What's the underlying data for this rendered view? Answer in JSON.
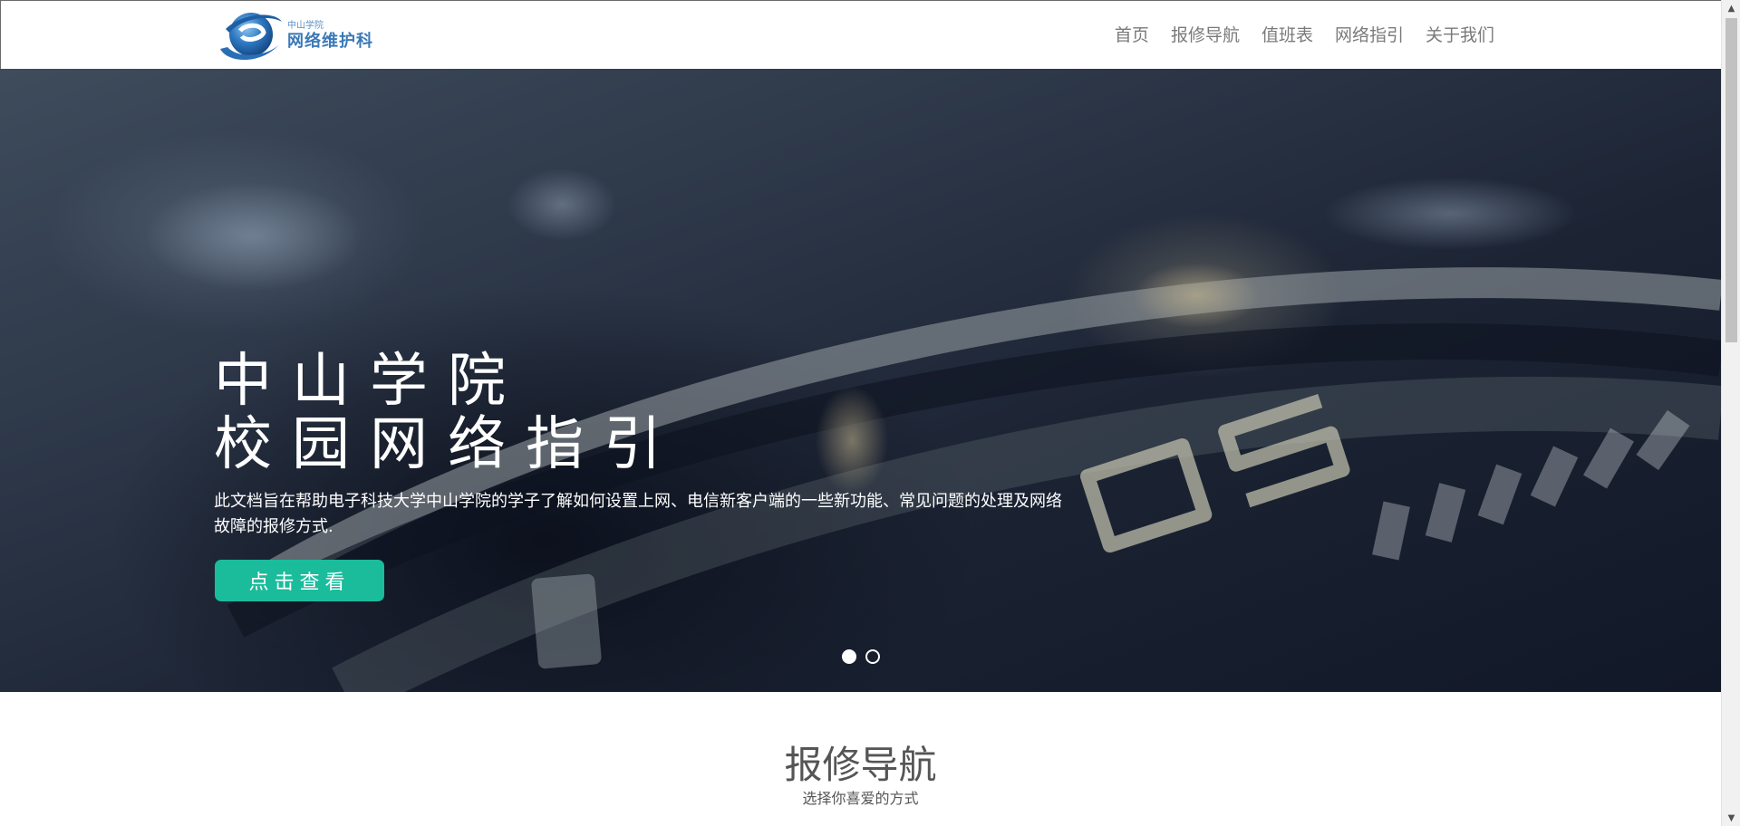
{
  "header": {
    "logo_sub": "中山学院",
    "logo_main": "网络维护科",
    "nav": [
      {
        "label": "首页"
      },
      {
        "label": "报修导航"
      },
      {
        "label": "值班表"
      },
      {
        "label": "网络指引"
      },
      {
        "label": "关于我们"
      }
    ]
  },
  "hero": {
    "title_line1": "中山学院",
    "title_line2": "校园网络指引",
    "description": "此文档旨在帮助电子科技大学中山学院的学子了解如何设置上网、电信新客户端的一些新功能、常见问题的处理及网络故障的报修方式.",
    "button_label": "点击查看",
    "slides_total": 2,
    "active_slide": 1
  },
  "section": {
    "title": "报修导航",
    "subtitle": "选择你喜爱的方式"
  },
  "colors": {
    "accent": "#1abc9c",
    "logo_blue": "#3b79b8",
    "nav_text": "#7a7a7a"
  },
  "icons": {
    "logo": "globe-logo-icon",
    "scroll_up": "triangle-up-icon",
    "scroll_down": "triangle-down-icon"
  }
}
